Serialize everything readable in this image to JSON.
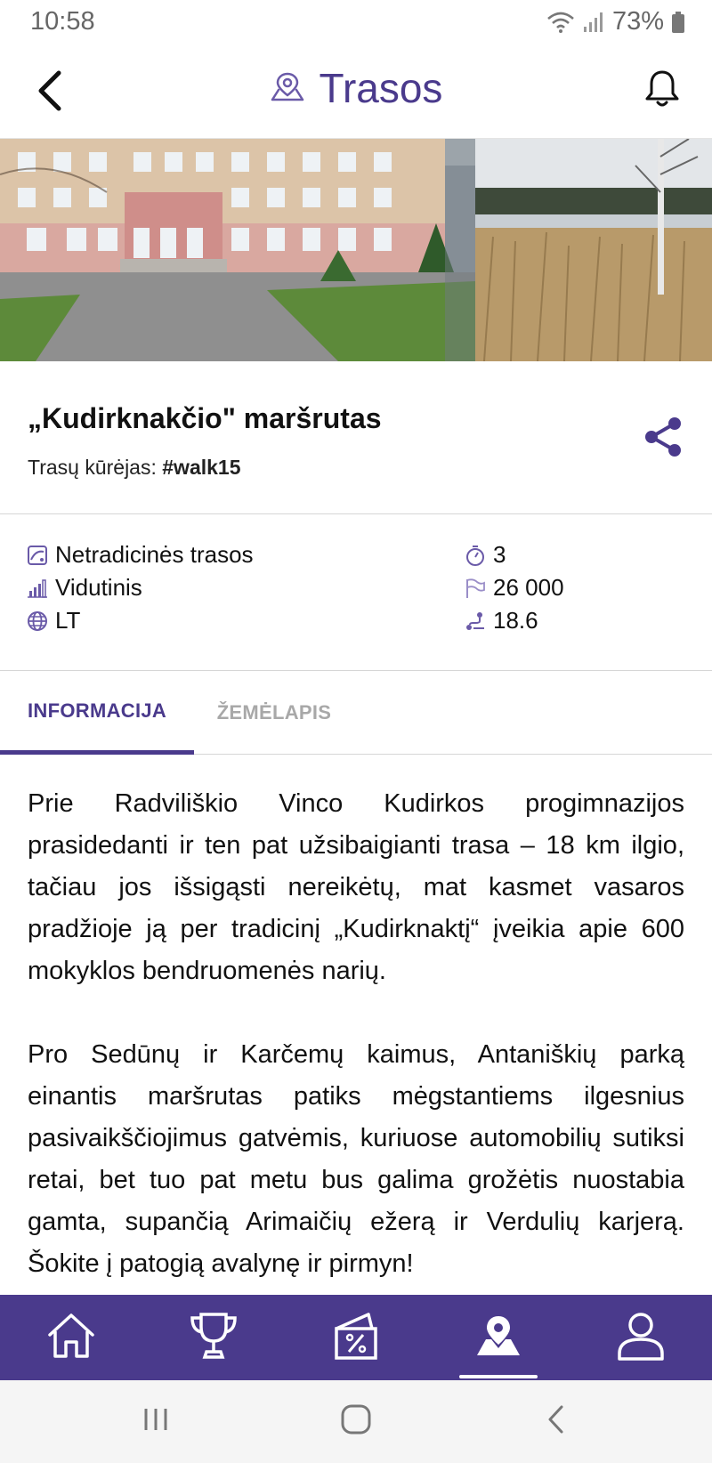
{
  "status_bar": {
    "time": "10:58",
    "battery": "73%",
    "icons": [
      "wifi-icon",
      "signal-icon",
      "battery-icon"
    ]
  },
  "header": {
    "title": "Trasos",
    "back_icon": "chevron-left-icon",
    "title_icon": "map-pin-icon",
    "notifications_icon": "bell-icon"
  },
  "hero": {
    "images": [
      "school-building-photo",
      "lake-reeds-photo"
    ]
  },
  "route": {
    "title": "„Kudirknakčio\" maršrutas",
    "author_label": "Trasų kūrėjas: ",
    "author_name": "#walk15",
    "share_icon": "share-icon"
  },
  "stats": {
    "left": [
      {
        "icon": "route-type-icon",
        "text": "Netradicinės trasos"
      },
      {
        "icon": "difficulty-icon",
        "text": "Vidutinis"
      },
      {
        "icon": "globe-icon",
        "text": "LT"
      }
    ],
    "right": [
      {
        "icon": "timer-icon",
        "text": "3"
      },
      {
        "icon": "steps-flag-icon",
        "text": "26 000"
      },
      {
        "icon": "distance-icon",
        "text": "18.6"
      }
    ]
  },
  "tabs": {
    "items": [
      {
        "label": "INFORMACIJA",
        "active": true
      },
      {
        "label": "ŽEMĖLAPIS",
        "active": false
      }
    ]
  },
  "description": {
    "paragraphs": [
      "Prie Radviliškio Vinco Kudirkos progimnazijos prasidedanti ir ten pat užsibaigianti trasa – 18 km ilgio, tačiau jos išsigąsti nereikėtų, mat kasmet vasaros pradžioje ją per tradicinį „Kudirknaktį“ įveikia apie 600 mokyklos bendruomenės narių.",
      "Pro Sedūnų ir Karčemų kaimus, Antaniškių parką einantis maršrutas patiks mėgstantiems ilgesnius pasivaikščiojimus gatvėmis, kuriuose automobilių sutiksi retai, bet tuo pat metu bus galima grožėtis nuostabia gamta, supančią Arimaičių ežerą ir Verdulių karjerą. Šokite į patogią avalynę ir pirmyn!"
    ]
  },
  "bottom_nav": {
    "items": [
      {
        "icon": "home-icon",
        "active": false
      },
      {
        "icon": "trophy-icon",
        "active": false
      },
      {
        "icon": "discount-tag-icon",
        "active": false
      },
      {
        "icon": "map-pin-icon",
        "active": true
      },
      {
        "icon": "profile-icon",
        "active": false
      }
    ]
  },
  "system_nav": {
    "items": [
      "recent-apps-icon",
      "home-circle-icon",
      "back-icon"
    ]
  },
  "colors": {
    "brand": "#4a3a8c",
    "tab_inactive": "#a8a8a8",
    "divider": "#d6d6d6"
  }
}
